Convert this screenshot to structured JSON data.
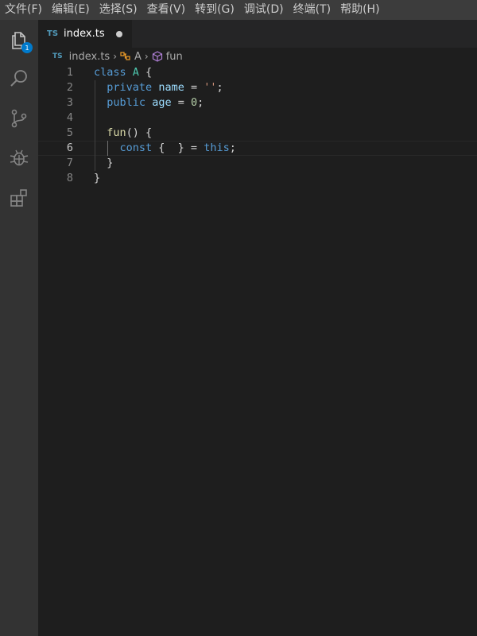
{
  "menu": {
    "items": [
      {
        "label": "文件(F)"
      },
      {
        "label": "编辑(E)"
      },
      {
        "label": "选择(S)"
      },
      {
        "label": "查看(V)"
      },
      {
        "label": "转到(G)"
      },
      {
        "label": "调试(D)"
      },
      {
        "label": "终端(T)"
      },
      {
        "label": "帮助(H)"
      }
    ]
  },
  "activity_bar": {
    "icons": [
      "explorer-icon",
      "search-icon",
      "source-control-icon",
      "debug-icon",
      "extensions-icon"
    ],
    "explorer_badge": "1",
    "accent": "#007acc"
  },
  "tab": {
    "lang_badge": "TS",
    "label": "index.ts",
    "modified": true
  },
  "breadcrumb": {
    "lang_badge": "TS",
    "file": "index.ts",
    "class": "A",
    "method": "fun"
  },
  "editor": {
    "active_line": 6,
    "lines": [
      {
        "number": "1",
        "tokens": [
          {
            "t": "kw",
            "v": "class"
          },
          {
            "t": "pun",
            "v": " "
          },
          {
            "t": "cls",
            "v": "A"
          },
          {
            "t": "pun",
            "v": " {"
          }
        ]
      },
      {
        "number": "2",
        "tokens": [
          {
            "t": "pun",
            "v": "  "
          },
          {
            "t": "kw",
            "v": "private"
          },
          {
            "t": "pun",
            "v": " "
          },
          {
            "t": "prop",
            "v": "name"
          },
          {
            "t": "pun",
            "v": " = "
          },
          {
            "t": "str",
            "v": "''"
          },
          {
            "t": "pun",
            "v": ";"
          }
        ]
      },
      {
        "number": "3",
        "tokens": [
          {
            "t": "pun",
            "v": "  "
          },
          {
            "t": "kw",
            "v": "public"
          },
          {
            "t": "pun",
            "v": " "
          },
          {
            "t": "prop",
            "v": "age"
          },
          {
            "t": "pun",
            "v": " = "
          },
          {
            "t": "num",
            "v": "0"
          },
          {
            "t": "pun",
            "v": ";"
          }
        ]
      },
      {
        "number": "4",
        "tokens": []
      },
      {
        "number": "5",
        "tokens": [
          {
            "t": "pun",
            "v": "  "
          },
          {
            "t": "fn",
            "v": "fun"
          },
          {
            "t": "pun",
            "v": "() {"
          }
        ]
      },
      {
        "number": "6",
        "tokens": [
          {
            "t": "pun",
            "v": "    "
          },
          {
            "t": "kw",
            "v": "const"
          },
          {
            "t": "pun",
            "v": " {  } = "
          },
          {
            "t": "kw",
            "v": "this"
          },
          {
            "t": "pun",
            "v": ";"
          }
        ]
      },
      {
        "number": "7",
        "tokens": [
          {
            "t": "pun",
            "v": "  }"
          }
        ]
      },
      {
        "number": "8",
        "tokens": [
          {
            "t": "pun",
            "v": "}"
          }
        ]
      }
    ]
  }
}
